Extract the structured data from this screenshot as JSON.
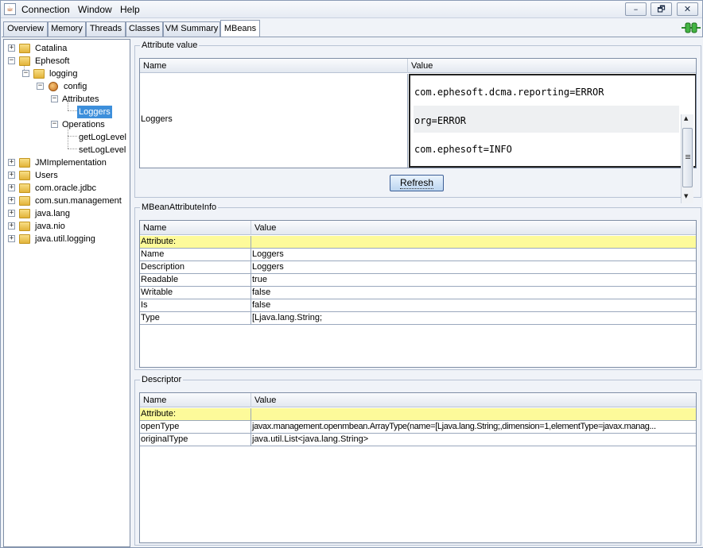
{
  "menubar": {
    "items": [
      "Connection",
      "Window",
      "Help"
    ],
    "window_buttons": [
      "–",
      "🗗",
      "✕"
    ]
  },
  "tabs": [
    "Overview",
    "Memory",
    "Threads",
    "Classes",
    "VM Summary",
    "MBeans"
  ],
  "active_tab": "MBeans",
  "tree": {
    "nodes": [
      {
        "label": "Catalina"
      },
      {
        "label": "Ephesoft"
      },
      {
        "label": "logging"
      },
      {
        "label": "config"
      },
      {
        "label": "Attributes"
      },
      {
        "label": "Loggers"
      },
      {
        "label": "Operations"
      },
      {
        "label": "getLogLevel"
      },
      {
        "label": "setLogLevel"
      },
      {
        "label": "JMImplementation"
      },
      {
        "label": "Users"
      },
      {
        "label": "com.oracle.jdbc"
      },
      {
        "label": "com.sun.management"
      },
      {
        "label": "java.lang"
      },
      {
        "label": "java.nio"
      },
      {
        "label": "java.util.logging"
      }
    ],
    "selected": "Loggers"
  },
  "attribute_value": {
    "title": "Attribute value",
    "col_name": "Name",
    "col_value": "Value",
    "name": "Loggers",
    "values": [
      "com.ephesoft.dcma.reporting=ERROR",
      "org=ERROR",
      "com.ephesoft=INFO"
    ],
    "refresh_label": "Refresh"
  },
  "mbean_info": {
    "title": "MBeanAttributeInfo",
    "col_name": "Name",
    "col_value": "Value",
    "rows": [
      [
        "Attribute:",
        ""
      ],
      [
        "Name",
        "Loggers"
      ],
      [
        "Description",
        "Loggers"
      ],
      [
        "Readable",
        "true"
      ],
      [
        "Writable",
        "false"
      ],
      [
        "Is",
        "false"
      ],
      [
        "Type",
        "[Ljava.lang.String;"
      ]
    ]
  },
  "descriptor": {
    "title": "Descriptor",
    "col_name": "Name",
    "col_value": "Value",
    "rows": [
      [
        "Attribute:",
        ""
      ],
      [
        "openType",
        "javax.management.openmbean.ArrayType(name=[Ljava.lang.String;,dimension=1,elementType=javax.manag..."
      ],
      [
        "originalType",
        "java.util.List<java.lang.String>"
      ]
    ]
  }
}
